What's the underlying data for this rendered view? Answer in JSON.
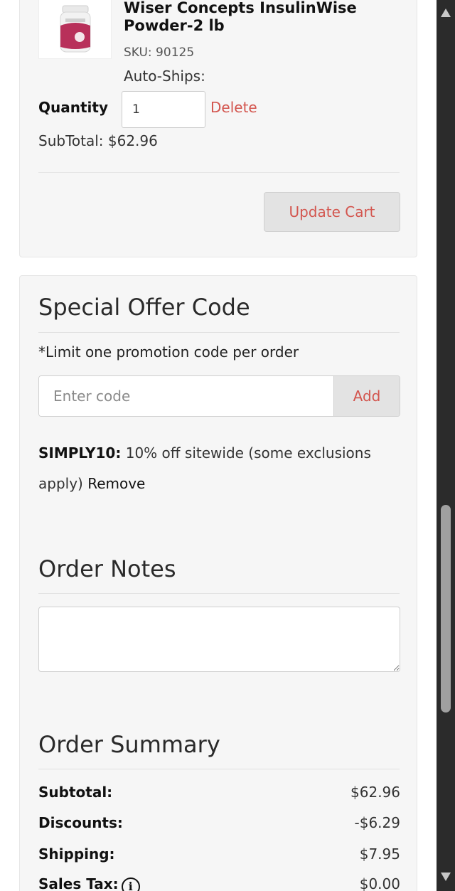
{
  "cart": {
    "product_title": "Wiser Concepts InsulinWise Powder-2 lb",
    "sku": "SKU: 90125",
    "autoship_label": "Auto-Ships:",
    "quantity_label": "Quantity",
    "quantity_value": "1",
    "delete_label": "Delete",
    "subtotal_line": "SubTotal: $62.96",
    "update_button": "Update Cart"
  },
  "offer": {
    "title": "Special Offer Code",
    "limit_note": "*Limit one promotion code per order",
    "code_placeholder": "Enter code",
    "add_button": "Add",
    "applied_code": "SIMPLY10:",
    "applied_description": " 10% off sitewide (some exclusions apply) ",
    "remove_label": "Remove"
  },
  "notes": {
    "title": "Order Notes",
    "value": ""
  },
  "summary": {
    "title": "Order Summary",
    "rows": [
      {
        "label": "Subtotal:",
        "value": "$62.96"
      },
      {
        "label": "Discounts:",
        "value": "-$6.29"
      },
      {
        "label": "Shipping:",
        "value": "$7.95"
      },
      {
        "label": "Sales Tax:",
        "value": "$0.00"
      }
    ],
    "info_icon": "i"
  },
  "colors": {
    "accent": "#d3554e",
    "card_bg": "#f6f6f6",
    "scrollbar_bg": "#2b2b2b"
  },
  "icons": {
    "product_image": "product-jar-icon",
    "info": "info-icon",
    "resize": "resize-grip-icon",
    "scroll_up": "chevron-up-icon",
    "scroll_down": "chevron-down-icon"
  }
}
